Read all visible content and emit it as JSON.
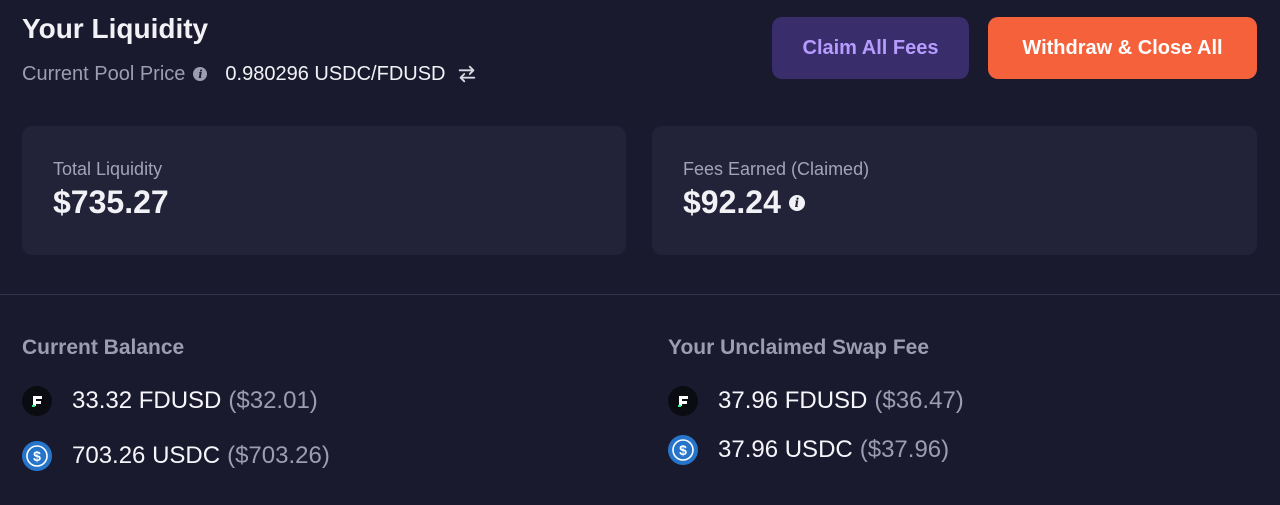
{
  "header": {
    "title": "Your Liquidity",
    "price_label": "Current Pool Price",
    "price_value": "0.980296 USDC/FDUSD"
  },
  "buttons": {
    "claim_label": "Claim All Fees",
    "withdraw_label": "Withdraw & Close All"
  },
  "cards": {
    "total_liquidity": {
      "label": "Total Liquidity",
      "value": "$735.27"
    },
    "fees_earned": {
      "label": "Fees Earned (Claimed)",
      "value": "$92.24"
    }
  },
  "current_balance": {
    "title": "Current Balance",
    "tokens": [
      {
        "amount": "33.32 FDUSD",
        "usd": "($32.01)",
        "icon": "fdusd-icon"
      },
      {
        "amount": "703.26 USDC",
        "usd": "($703.26)",
        "icon": "usdc-icon"
      }
    ]
  },
  "unclaimed_fee": {
    "title": "Your Unclaimed Swap Fee",
    "tokens": [
      {
        "amount": "37.96 FDUSD",
        "usd": "($36.47)",
        "icon": "fdusd-icon"
      },
      {
        "amount": "37.96 USDC",
        "usd": "($37.96)",
        "icon": "usdc-icon"
      }
    ]
  },
  "colors": {
    "background": "#1a1a2e",
    "card": "#222238",
    "claim_button": "#3a2d6b",
    "withdraw_button": "#f5613a",
    "usdc_blue": "#2775ca"
  }
}
